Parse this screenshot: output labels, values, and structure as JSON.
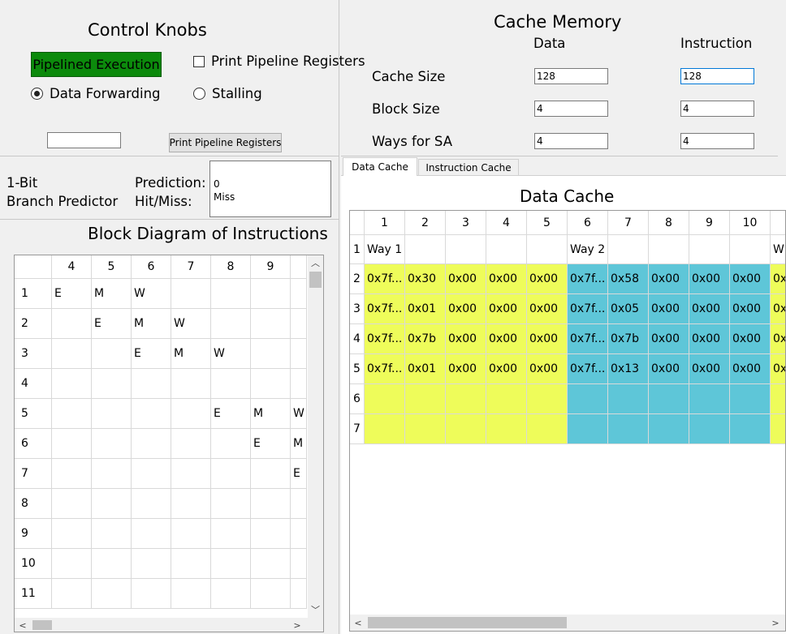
{
  "control": {
    "title": "Control Knobs",
    "pipelined_button": "Pipelined Execution",
    "print_registers_checkbox": "Print Pipeline Registers",
    "data_forwarding_radio": "Data Forwarding",
    "stalling_radio": "Stalling",
    "instruction_input": "",
    "print_registers_button": "Print Pipeline Registers"
  },
  "predictor": {
    "name_line1": "1-Bit",
    "name_line2": "Branch Predictor",
    "prediction_label": "Prediction:",
    "hitmiss_label": "Hit/Miss:",
    "prediction_value": "0",
    "hitmiss_value": "Miss"
  },
  "block_diagram": {
    "title": "Block Diagram of Instructions",
    "columns": [
      "4",
      "5",
      "6",
      "7",
      "8",
      "9",
      ""
    ],
    "rows": [
      {
        "n": "1",
        "cells": [
          "E",
          "M",
          "W",
          "",
          "",
          "",
          ""
        ]
      },
      {
        "n": "2",
        "cells": [
          "",
          "E",
          "M",
          "W",
          "",
          "",
          ""
        ]
      },
      {
        "n": "3",
        "cells": [
          "",
          "",
          "E",
          "M",
          "W",
          "",
          ""
        ]
      },
      {
        "n": "4",
        "cells": [
          "",
          "",
          "",
          "",
          "",
          "",
          ""
        ]
      },
      {
        "n": "5",
        "cells": [
          "",
          "",
          "",
          "",
          "E",
          "M",
          "W"
        ]
      },
      {
        "n": "6",
        "cells": [
          "",
          "",
          "",
          "",
          "",
          "E",
          "M"
        ]
      },
      {
        "n": "7",
        "cells": [
          "",
          "",
          "",
          "",
          "",
          "",
          "E"
        ]
      },
      {
        "n": "8",
        "cells": [
          "",
          "",
          "",
          "",
          "",
          "",
          ""
        ]
      },
      {
        "n": "9",
        "cells": [
          "",
          "",
          "",
          "",
          "",
          "",
          ""
        ]
      },
      {
        "n": "10",
        "cells": [
          "",
          "",
          "",
          "",
          "",
          "",
          ""
        ]
      },
      {
        "n": "11",
        "cells": [
          "",
          "",
          "",
          "",
          "",
          "",
          ""
        ]
      }
    ]
  },
  "cache_memory": {
    "title": "Cache Memory",
    "col_data": "Data",
    "col_instruction": "Instruction",
    "cache_size_label": "Cache Size",
    "block_size_label": "Block Size",
    "ways_label": "Ways for SA",
    "data_cache_size": "128",
    "instr_cache_size": "128",
    "data_block_size": "4",
    "instr_block_size": "4",
    "data_ways": "4",
    "instr_ways": "4"
  },
  "tabs": {
    "data_cache": "Data Cache",
    "instruction_cache": "Instruction Cache"
  },
  "data_cache": {
    "title": "Data Cache",
    "columns": [
      "1",
      "2",
      "3",
      "4",
      "5",
      "6",
      "7",
      "8",
      "9",
      "10",
      ""
    ],
    "rows": [
      {
        "n": "1",
        "cells": [
          "Way 1",
          "",
          "",
          "",
          "",
          "Way 2",
          "",
          "",
          "",
          "",
          "W"
        ]
      },
      {
        "n": "2",
        "cells": [
          "0x7f...",
          "0x30",
          "0x00",
          "0x00",
          "0x00",
          "0x7f...",
          "0x58",
          "0x00",
          "0x00",
          "0x00",
          "0x"
        ]
      },
      {
        "n": "3",
        "cells": [
          "0x7f...",
          "0x01",
          "0x00",
          "0x00",
          "0x00",
          "0x7f...",
          "0x05",
          "0x00",
          "0x00",
          "0x00",
          "0x"
        ]
      },
      {
        "n": "4",
        "cells": [
          "0x7f...",
          "0x7b",
          "0x00",
          "0x00",
          "0x00",
          "0x7f...",
          "0x7b",
          "0x00",
          "0x00",
          "0x00",
          "0x"
        ]
      },
      {
        "n": "5",
        "cells": [
          "0x7f...",
          "0x01",
          "0x00",
          "0x00",
          "0x00",
          "0x7f...",
          "0x13",
          "0x00",
          "0x00",
          "0x00",
          "0x"
        ]
      },
      {
        "n": "6",
        "cells": [
          "",
          "",
          "",
          "",
          "",
          "",
          "",
          "",
          "",
          "",
          ""
        ]
      },
      {
        "n": "7",
        "cells": [
          "",
          "",
          "",
          "",
          "",
          "",
          "",
          "",
          "",
          "",
          ""
        ]
      }
    ]
  },
  "colors": {
    "way1": "#eefc5a",
    "way2": "#5ec6d8",
    "pipelined_button_bg": "#0c8a0c"
  }
}
